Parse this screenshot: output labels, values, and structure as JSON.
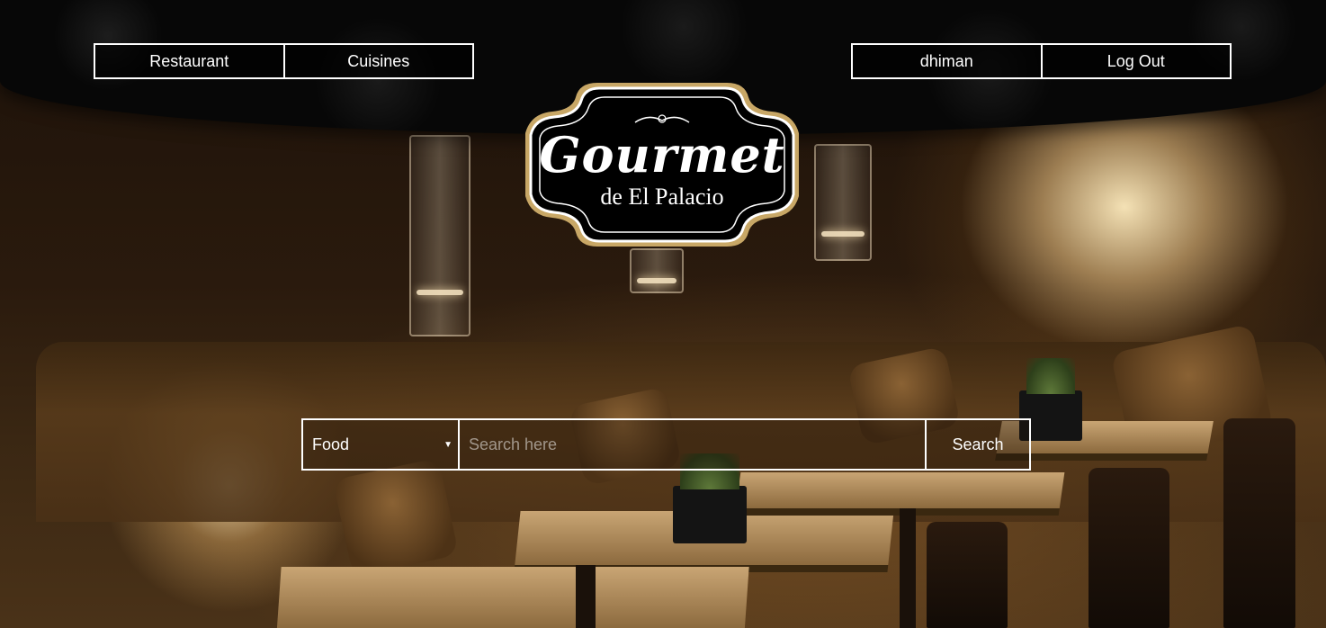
{
  "nav_left": {
    "restaurant_label": "Restaurant",
    "cuisines_label": "Cuisines"
  },
  "nav_right": {
    "user_label": "dhiman",
    "logout_label": "Log Out"
  },
  "logo": {
    "title": "Gourmet",
    "subtitle": "de El Palacio"
  },
  "search": {
    "category_value": "Food",
    "placeholder": "Search here",
    "button_label": "Search"
  },
  "colors": {
    "header": "#070707",
    "border": "#ffffff",
    "text": "#ffffff"
  }
}
